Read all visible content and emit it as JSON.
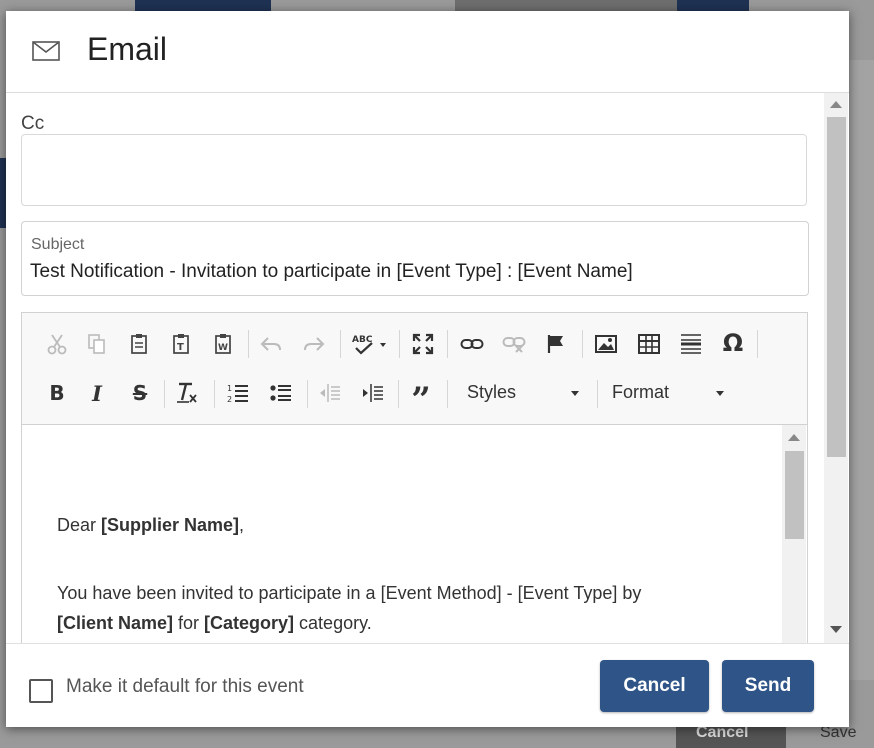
{
  "modal": {
    "title": "Email",
    "icon": "envelope-icon"
  },
  "cc": {
    "label": "Cc",
    "value": ""
  },
  "subject": {
    "label": "Subject",
    "value": "Test Notification - Invitation to participate in [Event Type] : [Event Name]"
  },
  "toolbar": {
    "row1": [
      "cut-icon",
      "copy-icon",
      "paste-icon",
      "paste-text-icon",
      "paste-word-icon",
      "undo-icon",
      "redo-icon",
      "spellcheck-icon",
      "maximize-icon",
      "link-icon",
      "unlink-icon",
      "anchor-flag-icon",
      "image-icon",
      "table-icon",
      "horizontal-line-icon",
      "special-char-icon"
    ],
    "row2": [
      "bold-icon",
      "italic-icon",
      "strikethrough-icon",
      "remove-format-icon",
      "numbered-list-icon",
      "bulleted-list-icon",
      "outdent-icon",
      "indent-icon",
      "blockquote-icon"
    ],
    "styles_label": "Styles",
    "format_label": "Format",
    "spellcheck_text": "ABC",
    "omega": "Ω"
  },
  "body": {
    "greeting_prefix": "Dear ",
    "greeting_bold": "[Supplier Name]",
    "greeting_suffix": ",",
    "line1": "You have been invited to participate in a [Event Method] - [Event Type] by",
    "line2_bold1": "[Client Name]",
    "line2_mid": " for ",
    "line2_bold2": "[Category]",
    "line2_end": " category."
  },
  "footer": {
    "checkbox_label": "Make it default for this event",
    "checkbox_checked": false,
    "cancel_label": "Cancel",
    "send_label": "Send"
  },
  "background": {
    "partial_button": "Cancel",
    "partial_text": "Save"
  },
  "colors": {
    "primary": "#2e5488",
    "overlay": "#8f8f8f"
  }
}
